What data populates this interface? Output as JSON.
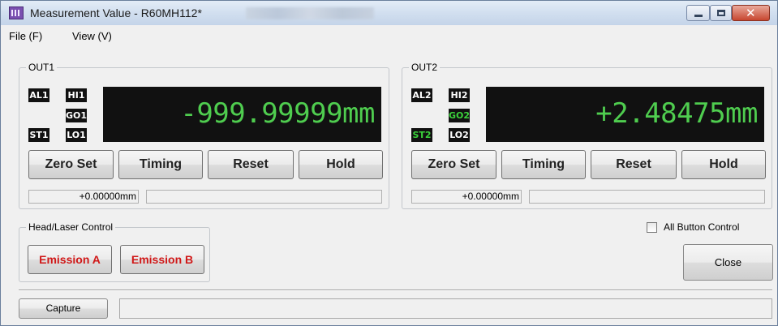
{
  "window": {
    "title": "Measurement Value - R60MH112*"
  },
  "menu": {
    "file": "File (F)",
    "view": "View (V)"
  },
  "out1": {
    "legend": "OUT1",
    "indicators": {
      "al": "AL1",
      "hi": "HI1",
      "go": "GO1",
      "st": "ST1",
      "lo": "LO1"
    },
    "active_indicators": [],
    "value": "-999.99999mm",
    "buttons": {
      "zero_set": "Zero Set",
      "timing": "Timing",
      "reset": "Reset",
      "hold": "Hold"
    },
    "offset": "+0.00000mm",
    "message": ""
  },
  "out2": {
    "legend": "OUT2",
    "indicators": {
      "al": "AL2",
      "hi": "HI2",
      "go": "GO2",
      "st": "ST2",
      "lo": "LO2"
    },
    "active_indicators": [
      "GO2",
      "ST2"
    ],
    "value": "+2.48475mm",
    "buttons": {
      "zero_set": "Zero Set",
      "timing": "Timing",
      "reset": "Reset",
      "hold": "Hold"
    },
    "offset": "+0.00000mm",
    "message": ""
  },
  "head_laser": {
    "legend": "Head/Laser Control",
    "emission_a": "Emission A",
    "emission_b": "Emission B"
  },
  "all_button_control": {
    "label": "All Button Control",
    "checked": false
  },
  "close_label": "Close",
  "capture_label": "Capture",
  "capture_status": "",
  "colors": {
    "display_bg": "#111111",
    "display_text": "#4fcd4f",
    "indicator_active": "#3bd33b",
    "emission_text": "#d01818"
  }
}
